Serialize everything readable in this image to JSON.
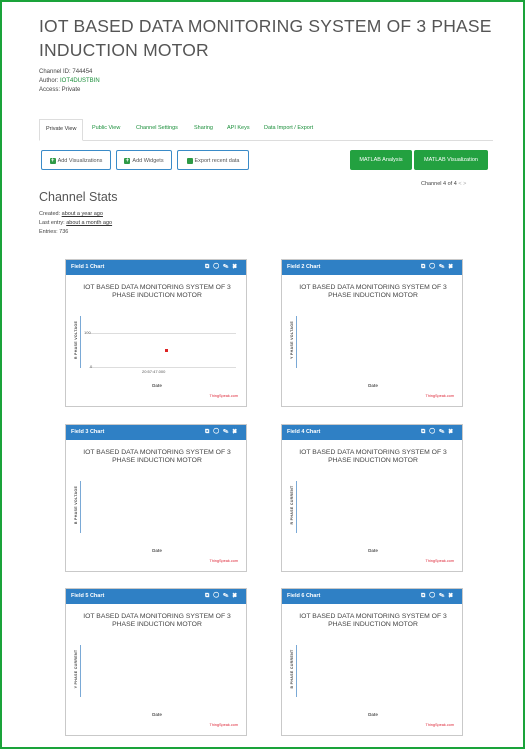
{
  "channel": {
    "title": "IOT BASED DATA MONITORING SYSTEM OF 3 PHASE INDUCTION MOTOR",
    "id_label": "Channel ID: 744454",
    "author_prefix": "Author: ",
    "author": "IOT4DUSTBIN",
    "access": "Access: Private"
  },
  "tabs": [
    "Private View",
    "Public View",
    "Channel Settings",
    "Sharing",
    "API Keys",
    "Data Import / Export"
  ],
  "actions": {
    "add_visualizations": "Add Visualizations",
    "add_widgets": "Add Widgets",
    "export_recent": "Export recent data",
    "matlab_analysis": "MATLAB Analysis",
    "matlab_visualization": "MATLAB Visualization"
  },
  "pager": {
    "text": "Channel 4 of 4",
    "prev": "<",
    "next": ">"
  },
  "stats": {
    "heading": "Channel Stats",
    "created_label": "Created:",
    "created_value": "about a year ago",
    "last_entry_label": "Last entry:",
    "last_entry_value": "about a month ago",
    "entries": "Entries: 736"
  },
  "chart_common": {
    "title": "IOT BASED DATA MONITORING SYSTEM OF 3 PHASE INDUCTION MOTOR",
    "xlabel": "Date",
    "credit": "ThingSpeak.com",
    "icons": [
      "external-link-icon",
      "comment-icon",
      "edit-icon",
      "close-icon"
    ]
  },
  "charts": [
    {
      "header": "Field 1 Chart",
      "ylabel": "R PHASE VOLTAGE"
    },
    {
      "header": "Field 2 Chart",
      "ylabel": "Y PHASE VOLTAGE"
    },
    {
      "header": "Field 3 Chart",
      "ylabel": "B PHASE VOLTAGE"
    },
    {
      "header": "Field 4 Chart",
      "ylabel": "R PHASE CURRENT"
    },
    {
      "header": "Field 5 Chart",
      "ylabel": "Y PHASE CURRENT"
    },
    {
      "header": "Field 6 Chart",
      "ylabel": "B PHASE CURRENT"
    }
  ],
  "chart_data": [
    {
      "type": "scatter",
      "title": "IOT BASED DATA MONITORING SYSTEM OF 3 PHASE INDUCTION MOTOR",
      "xlabel": "Date",
      "ylabel": "R PHASE VOLTAGE",
      "y_ticks": [
        "100",
        "0"
      ],
      "x_ticks": [
        "20:57:47.000"
      ],
      "points": [
        {
          "x": "20:57:47.000",
          "y": 50
        }
      ],
      "ylim": [
        0,
        100
      ],
      "colors": {
        "point": "#dd2222",
        "header": "#2f80c5"
      }
    }
  ]
}
